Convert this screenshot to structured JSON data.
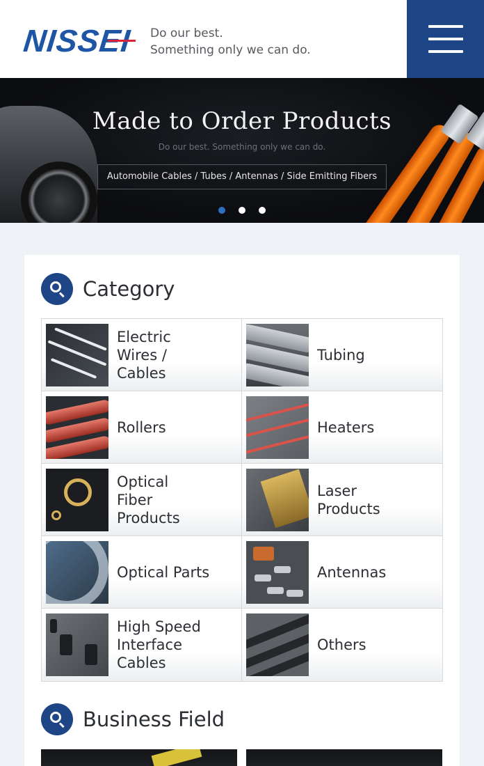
{
  "header": {
    "logo_text": "NISSEI",
    "tagline_line1": "Do our best.",
    "tagline_line2": "Something only we can do.",
    "menu_icon": "hamburger-menu-icon",
    "brand_color": "#1e4585"
  },
  "hero": {
    "title": "Made to Order Products",
    "subtitle": "Do our best. Something only we can do.",
    "products_line": "Automobile Cables / Tubes / Antennas / Side Emitting Fibers",
    "slides_total": 3,
    "active_slide": 1
  },
  "category": {
    "title": "Category",
    "icon": "search-icon",
    "items": [
      {
        "label": "Electric Wires / Cables",
        "icon": "electric-wires-image"
      },
      {
        "label": "Tubing",
        "icon": "tubing-image"
      },
      {
        "label": "Rollers",
        "icon": "rollers-image"
      },
      {
        "label": "Heaters",
        "icon": "heaters-image"
      },
      {
        "label": "Optical Fiber Products",
        "icon": "optical-fiber-image"
      },
      {
        "label": "Laser Products",
        "icon": "laser-products-image"
      },
      {
        "label": "Optical Parts",
        "icon": "optical-parts-image"
      },
      {
        "label": "Antennas",
        "icon": "antennas-image"
      },
      {
        "label": "High Speed Interface Cables",
        "icon": "high-speed-cables-image"
      },
      {
        "label": "Others",
        "icon": "others-image"
      }
    ]
  },
  "business": {
    "title": "Business Field",
    "icon": "search-icon"
  }
}
